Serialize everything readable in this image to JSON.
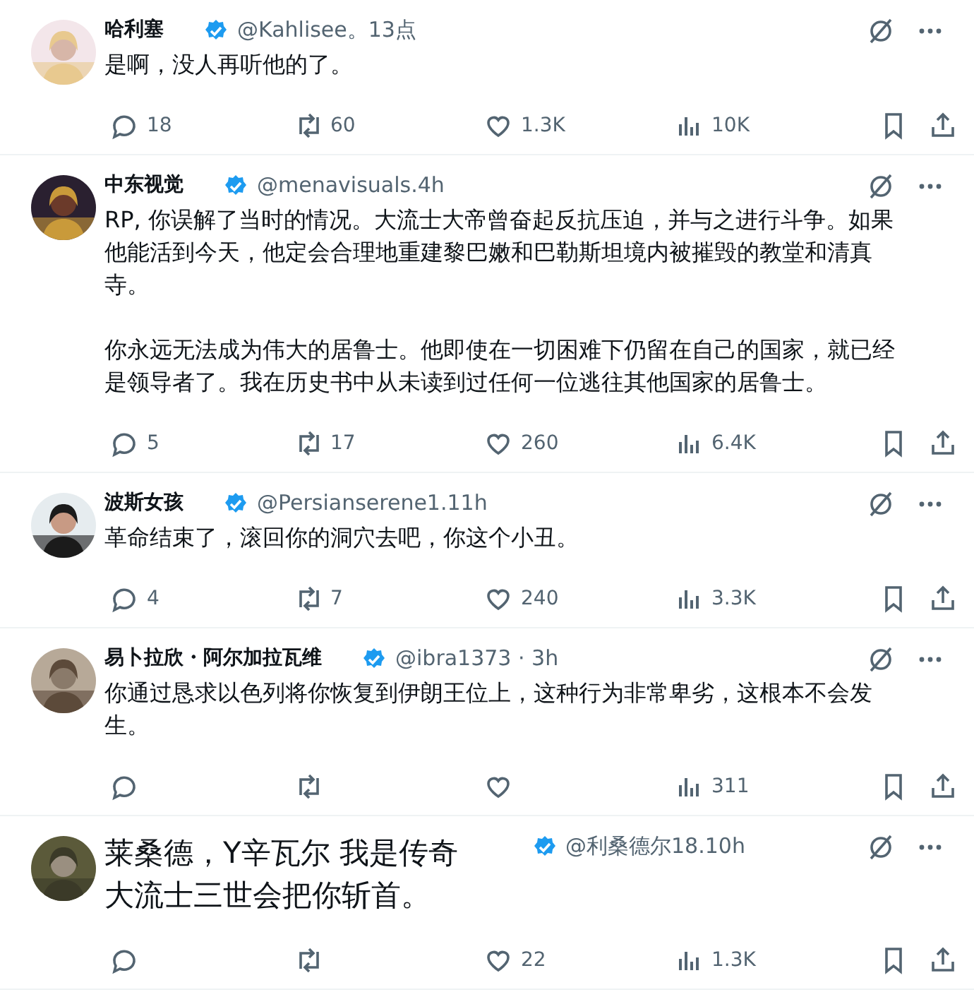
{
  "posts": [
    {
      "kind": "regular",
      "name": "哈利塞",
      "handle": "@Kahlisee。13点",
      "verified": true,
      "paragraphs": [
        "是啊，没人再听他的了。"
      ],
      "stats": [
        {
          "kind": "reply",
          "count": "18"
        },
        {
          "kind": "repost",
          "count": "60"
        },
        {
          "kind": "like",
          "count": "1.3K"
        },
        {
          "kind": "views",
          "count": "10K"
        },
        {
          "kind": "bookmark"
        },
        {
          "kind": "share"
        }
      ]
    },
    {
      "kind": "regular",
      "name": "中东视觉",
      "handle": "@menavisuals.4h",
      "verified": true,
      "paragraphs": [
        "RP, 你误解了当时的情况。大流士大帝曾奋起反抗压迫，并与之进行斗争。如果他能活到今天，他定会合理地重建黎巴嫩和巴勒斯坦境内被摧毁的教堂和清真寺。",
        "你永远无法成为伟大的居鲁士。他即使在一切困难下仍留在自己的国家，就已经是领导者了。我在历史书中从未读到过任何一位逃往其他国家的居鲁士。"
      ],
      "stats": [
        {
          "kind": "reply",
          "count": "5"
        },
        {
          "kind": "repost",
          "count": "17"
        },
        {
          "kind": "like",
          "count": "260"
        },
        {
          "kind": "views",
          "count": "6.4K"
        },
        {
          "kind": "bookmark"
        },
        {
          "kind": "share"
        }
      ]
    },
    {
      "kind": "regular",
      "name": "波斯女孩",
      "handle": "@Persianserene1.11h",
      "verified": true,
      "paragraphs": [
        "革命结束了，滚回你的洞穴去吧，你这个小丑。"
      ],
      "stats": [
        {
          "kind": "reply",
          "count": "4"
        },
        {
          "kind": "repost",
          "count": "7"
        },
        {
          "kind": "like",
          "count": "240"
        },
        {
          "kind": "views",
          "count": "3.3K"
        },
        {
          "kind": "bookmark"
        },
        {
          "kind": "share"
        }
      ]
    },
    {
      "kind": "regular",
      "name": "易卜拉欣・阿尔加拉瓦维",
      "handle": "@ibra1373 · 3h",
      "verified": true,
      "paragraphs": [
        "你通过恳求以色列将你恢复到伊朗王位上，这种行为非常卑劣，这根本不会发生。"
      ],
      "stats": [
        {
          "kind": "reply"
        },
        {
          "kind": "repost"
        },
        {
          "kind": "like"
        },
        {
          "kind": "views",
          "count": "311"
        },
        {
          "kind": "bookmark"
        },
        {
          "kind": "share"
        }
      ]
    },
    {
      "kind": "large",
      "name": "莱桑德，Y辛瓦尔 我是传奇",
      "handle": "@利桑德尔18.10h",
      "verified": true,
      "paragraphs": [
        "大流士三世会把你斩首。"
      ],
      "stats": [
        {
          "kind": "reply"
        },
        {
          "kind": "repost"
        },
        {
          "kind": "like",
          "count": "22"
        },
        {
          "kind": "views",
          "count": "1.3K"
        },
        {
          "kind": "bookmark"
        },
        {
          "kind": "share"
        }
      ]
    }
  ]
}
